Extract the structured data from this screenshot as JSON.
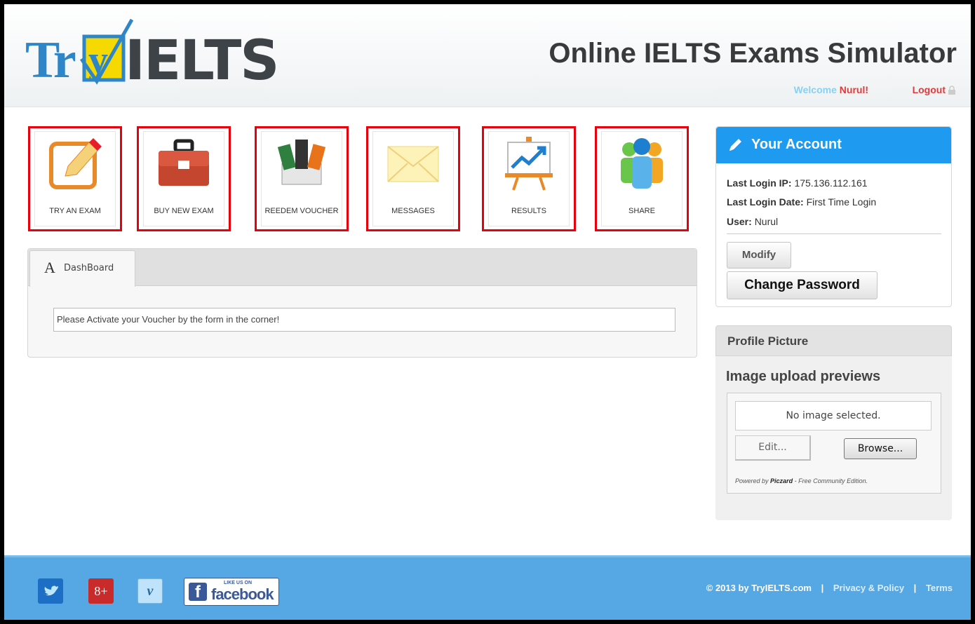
{
  "header": {
    "logo_text": "TryIELTS",
    "logo_parts": {
      "first": "Tr",
      "check": "y",
      "rest": "IELTS"
    },
    "title": "Online IELTS Exams Simulator",
    "welcome_label": "Welcome",
    "user_name": "Nurul!",
    "logout_label": "Logout"
  },
  "tiles": [
    {
      "label": "TRY AN EXAM",
      "icon": "edit-pencil-icon"
    },
    {
      "label": "BUY NEW EXAM",
      "icon": "briefcase-icon"
    },
    {
      "label": "REEDEM VOUCHER",
      "icon": "voucher-icon"
    },
    {
      "label": "MESSAGES",
      "icon": "envelope-icon"
    },
    {
      "label": "RESULTS",
      "icon": "chart-board-icon"
    },
    {
      "label": "SHARE",
      "icon": "people-icon"
    }
  ],
  "dashboard": {
    "tab_label": "DashBoard",
    "tab_icon_text": "A",
    "notice": "Please Activate your Voucher by the form in the corner!"
  },
  "account": {
    "title": "Your Account",
    "last_login_ip_label": "Last Login IP:",
    "last_login_ip": "175.136.112.161",
    "last_login_date_label": "Last Login Date:",
    "last_login_date": "First Time Login",
    "user_label": "User:",
    "user": "Nurul",
    "modify_label": "Modify",
    "change_password_label": "Change Password"
  },
  "profile_picture": {
    "title": "Profile Picture",
    "subtitle": "Image upload previews",
    "no_image": "No image selected.",
    "edit_label": "Edit...",
    "browse_label": "Browse...",
    "powered_prefix": "Powered by",
    "powered_brand": "Piczard",
    "powered_suffix": "- Free Community Edition."
  },
  "footer": {
    "copyright": "© 2013 by TryIELTS.com",
    "separator": "|",
    "privacy_label": "Privacy & Policy",
    "terms_label": "Terms",
    "facebook_like": "LIKE US ON",
    "facebook_text": "facebook",
    "gplus_text": "8+",
    "vimeo_text": "v"
  },
  "colors": {
    "accent_blue": "#1e9af0",
    "footer_blue": "#55a8e4",
    "highlight_red": "#e8000d",
    "logout_red": "#e03a3a",
    "welcome_blue": "#8ad0f0"
  }
}
